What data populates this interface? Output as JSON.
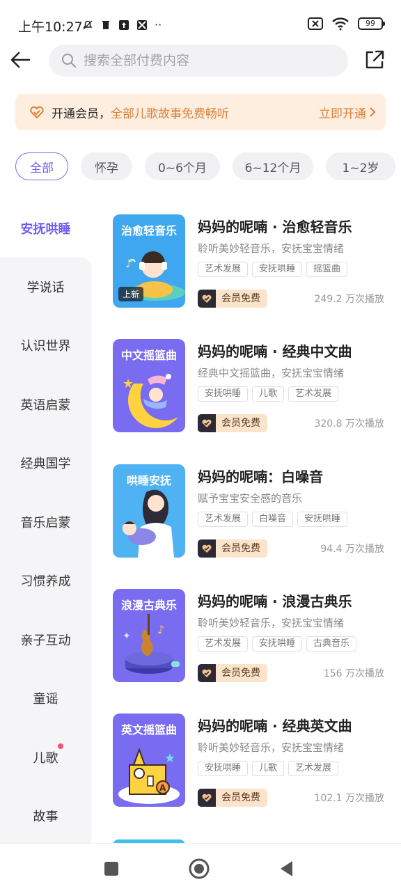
{
  "status_bar": {
    "time": "上午10:27",
    "battery": "99"
  },
  "header": {
    "search_placeholder": "搜索全部付费内容"
  },
  "vip_banner": {
    "text": "开通会员，",
    "highlight": "全部儿歌故事免费畅听",
    "action": "立即开通"
  },
  "age_filters": [
    {
      "label": "全部",
      "selected": true
    },
    {
      "label": "怀孕",
      "selected": false
    },
    {
      "label": "0~6个月",
      "selected": false
    },
    {
      "label": "6~12个月",
      "selected": false
    },
    {
      "label": "1~2岁",
      "selected": false
    }
  ],
  "sidebar": {
    "selected": "安抚哄睡",
    "items": [
      "安抚哄睡",
      "学说话",
      "认识世界",
      "英语启蒙",
      "经典国学",
      "音乐启蒙",
      "习惯养成",
      "亲子互动",
      "童谣",
      "儿歌",
      "故事"
    ]
  },
  "items": [
    {
      "cover_title": "治愈轻音乐",
      "cover_badge": "上新",
      "cover_color": "#3fa7ef",
      "title": "妈妈的呢喃 · 治愈轻音乐",
      "desc": "聆听美妙轻音乐，安抚宝宝情绪",
      "tags": [
        "艺术发展",
        "安抚哄睡",
        "摇篮曲"
      ],
      "vip_label": "会员免费",
      "plays": "249.2 万次播放"
    },
    {
      "cover_title": "中文摇篮曲",
      "cover_color": "#7a6cf0",
      "title": "妈妈的呢喃 · 经典中文曲",
      "desc": "经典中文摇篮曲，安抚宝宝情绪",
      "tags": [
        "安抚哄睡",
        "儿歌",
        "艺术发展"
      ],
      "vip_label": "会员免费",
      "plays": "320.8 万次播放"
    },
    {
      "cover_title": "哄睡安抚",
      "cover_color": "#4fb2f2",
      "title": "妈妈的呢喃：白噪音",
      "desc": "赋予宝宝安全感的音乐",
      "tags": [
        "艺术发展",
        "白噪音",
        "安抚哄睡"
      ],
      "vip_label": "会员免费",
      "plays": "94.4 万次播放"
    },
    {
      "cover_title": "浪漫古典乐",
      "cover_color": "#7a6cf0",
      "title": "妈妈的呢喃 · 浪漫古典乐",
      "desc": "聆听美妙轻音乐，安抚宝宝情绪",
      "tags": [
        "艺术发展",
        "安抚哄睡",
        "古典音乐"
      ],
      "vip_label": "会员免费",
      "plays": "156 万次播放"
    },
    {
      "cover_title": "英文摇篮曲",
      "cover_color": "#7a6cf0",
      "title": "妈妈的呢喃 · 经典英文曲",
      "desc": "聆听美妙轻音乐，安抚宝宝情绪",
      "tags": [
        "安抚哄睡",
        "儿歌",
        "艺术发展"
      ],
      "vip_label": "会员免费",
      "plays": "102.1 万次播放"
    }
  ],
  "icons": {
    "back": "arrow-left-icon",
    "search": "search-icon",
    "share": "share-icon",
    "vip": "vip-heart-icon",
    "chevron": "chevron-right-icon"
  }
}
